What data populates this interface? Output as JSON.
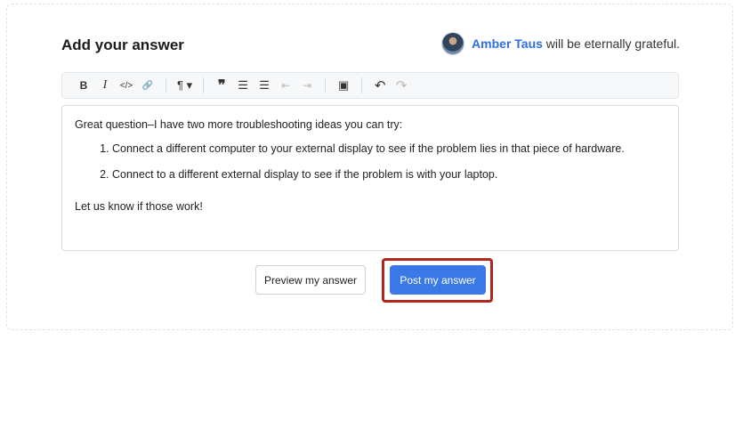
{
  "answer": {
    "title": "Add your answer",
    "grateful": {
      "user": "Amber Taus",
      "text": " will be eternally grateful."
    }
  },
  "toolbar": {
    "items": [
      {
        "icon": "bold-icon",
        "glyph": "B"
      },
      {
        "icon": "italic-icon",
        "glyph": "I"
      },
      {
        "icon": "code-icon",
        "glyph": "</>"
      },
      {
        "icon": "link-icon",
        "glyph": "🔗"
      },
      {
        "icon": "paragraph-icon",
        "glyph": "¶ ▾"
      },
      {
        "icon": "blockquote-icon",
        "glyph": "❞"
      },
      {
        "icon": "bulleted-list-icon",
        "glyph": "☰"
      },
      {
        "icon": "numbered-list-icon",
        "glyph": "☰"
      },
      {
        "icon": "outdent-icon",
        "glyph": "⇤"
      },
      {
        "icon": "indent-icon",
        "glyph": "⇥"
      },
      {
        "icon": "image-icon",
        "glyph": "▣"
      },
      {
        "icon": "undo-icon",
        "glyph": "↶"
      },
      {
        "icon": "redo-icon",
        "glyph": "↷"
      }
    ]
  },
  "editor": {
    "intro": "Great question–I have two more troubleshooting ideas you can try:",
    "list": [
      "Connect a different computer to your external display to see if the problem lies in that piece of hardware.",
      "Connect to a different external display to see if the problem is with your laptop."
    ],
    "closing": "Let us know if those work!"
  },
  "buttons": {
    "preview_label": "Preview my answer",
    "post_label": "Post my answer"
  },
  "colors": {
    "accent": "#3b78e7",
    "highlight": "#b3261e",
    "user_link": "#2f6fe0"
  }
}
